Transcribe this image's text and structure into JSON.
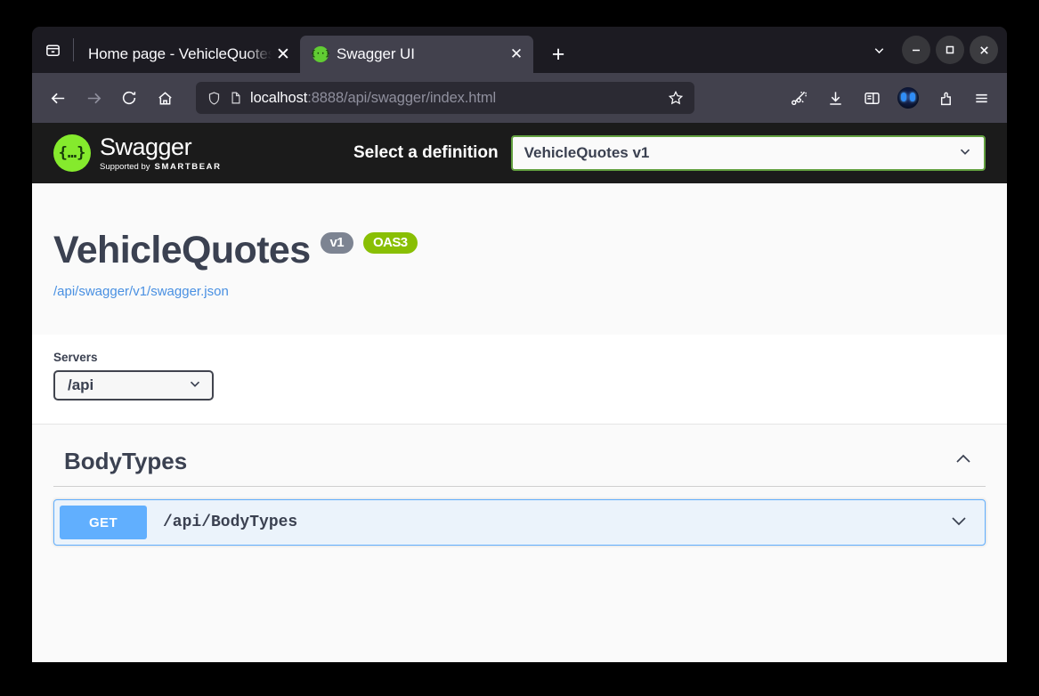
{
  "browser": {
    "tab_list_icon": "tab-list-icon",
    "tabs": [
      {
        "title": "Home page - VehicleQuotes.",
        "favicon": "box-icon",
        "close_label": "✕",
        "active": false
      },
      {
        "title": "Swagger UI",
        "favicon": "swagger-favicon",
        "close_label": "✕",
        "active": true
      }
    ],
    "new_tab_label": "+",
    "tab_overflow_icon": "chevron-down-icon",
    "window_controls": {
      "minimize": "–",
      "maximize": "□",
      "close": "✕"
    },
    "nav": {
      "back_icon": "back-arrow-icon",
      "forward_icon": "forward-arrow-icon",
      "reload_icon": "reload-icon",
      "home_icon": "home-icon"
    },
    "url": {
      "shield_icon": "shield-icon",
      "page_icon": "page-icon",
      "host": "localhost",
      "path": ":8888/api/swagger/index.html",
      "full": "localhost:8888/api/swagger/index.html",
      "bookmark_icon": "star-icon"
    },
    "toolbar_icons": [
      "screenshot-icon",
      "downloads-icon",
      "sidebar-icon",
      "account-avatar-icon",
      "extensions-icon",
      "app-menu-icon"
    ]
  },
  "swagger": {
    "logo": {
      "glyph": "{…}",
      "name": "Swagger",
      "trademark": ".",
      "supported_by": "Supported by",
      "brand": "SMARTBEAR"
    },
    "definition": {
      "label": "Select a definition",
      "selected": "VehicleQuotes v1",
      "chevron": "chevron-down-icon"
    },
    "info": {
      "title": "VehicleQuotes",
      "version_pill": "v1",
      "oas_pill": "OAS3",
      "spec_link": "/api/swagger/v1/swagger.json"
    },
    "servers": {
      "label": "Servers",
      "selected": "/api",
      "chevron": "chevron-down-icon"
    },
    "tags": [
      {
        "name": "BodyTypes",
        "expanded": true,
        "collapse_icon": "chevron-up-icon",
        "operations": [
          {
            "method": "GET",
            "path": "/api/BodyTypes",
            "expand_icon": "chevron-down-icon"
          }
        ]
      }
    ],
    "colors": {
      "get": "#61affe",
      "oas_green": "#89bf04",
      "version_gray": "#7d8492",
      "text": "#3b4151",
      "link": "#4990e2"
    }
  }
}
